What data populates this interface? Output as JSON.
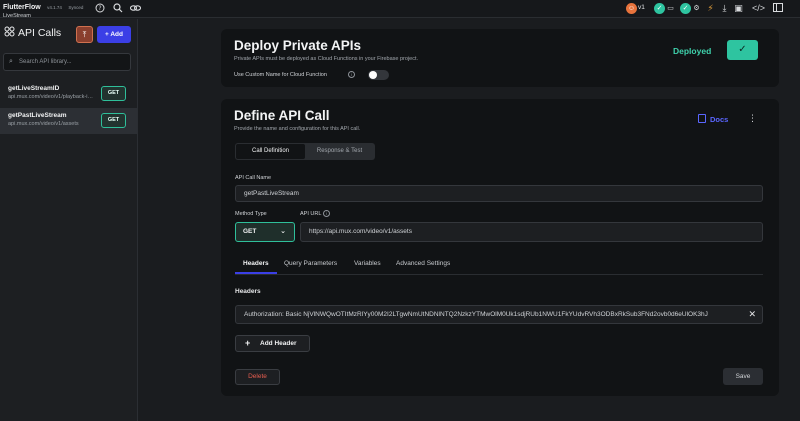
{
  "app": {
    "name": "FlutterFlow",
    "version": "v4.1.74",
    "sync_status": "Synced",
    "project": "LiveStream"
  },
  "topbar": {
    "version_tag": "v1"
  },
  "sidebar": {
    "title": "API Calls",
    "add_label": "+ Add",
    "search_placeholder": "Search API library...",
    "items": [
      {
        "name": "getLiveStreamID",
        "url": "api.mux.com/video/v1/playback-ids/{id}",
        "method": "GET",
        "selected": false
      },
      {
        "name": "getPastLiveStream",
        "url": "api.mux.com/video/v1/assets",
        "method": "GET",
        "selected": true
      }
    ]
  },
  "deploy": {
    "title": "Deploy Private APIs",
    "subtitle": "Private APIs must be deployed as Cloud Functions in your Firebase project.",
    "custom_name_label": "Use Custom Name for Cloud Function",
    "custom_name_enabled": false,
    "status": "Deployed"
  },
  "define": {
    "title": "Define API Call",
    "subtitle": "Provide the name and configuration for this API call.",
    "docs_label": "Docs",
    "segments": [
      "Call Definition",
      "Response & Test"
    ],
    "api_call_name_label": "API Call Name",
    "api_call_name": "getPastLiveStream",
    "method_type_label": "Method Type",
    "method": "GET",
    "api_url_label": "API URL",
    "api_url": "https://api.mux.com/video/v1/assets",
    "tabs": [
      "Headers",
      "Query Parameters",
      "Variables",
      "Advanced Settings"
    ],
    "headers_label": "Headers",
    "headers": [
      "Authorization: Basic NjVlNWQwOTItMzRlYy00M2I2LTgwNmUtNDNlNTQ2NzkzYTMwOlM0Uk1sdjRUb1NWU1FkYUdvRVh3ODBxRkSub3FNd2ovb0d6eUlOK3hJ"
    ],
    "add_header_label": "Add Header",
    "delete_label": "Delete",
    "save_label": "Save"
  },
  "colors": {
    "accent": "#3b3fe6",
    "success": "#2ec4a0",
    "danger": "#e65d4f"
  }
}
